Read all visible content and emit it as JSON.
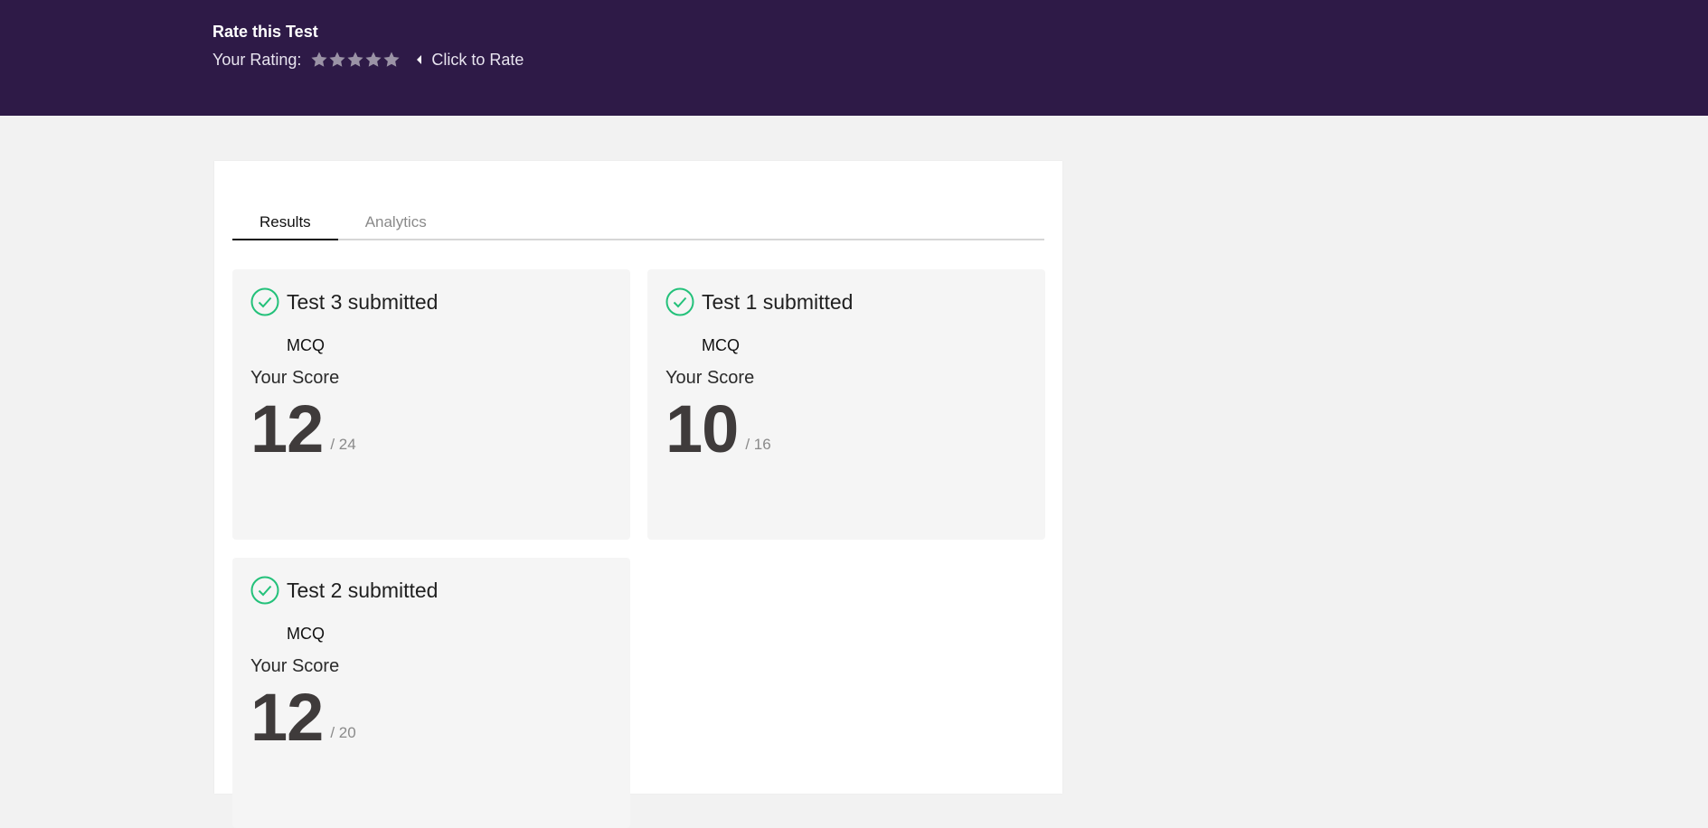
{
  "rating": {
    "title": "Rate this Test",
    "label": "Your Rating:",
    "stars_total": 5,
    "stars_selected": 0,
    "star_color": "#9b93a6",
    "action_label": "Click to Rate"
  },
  "tabs": [
    {
      "label": "Results",
      "active": true
    },
    {
      "label": "Analytics",
      "active": false
    }
  ],
  "results": [
    {
      "title": "Test 3 submitted",
      "type": "MCQ",
      "score_label": "Your Score",
      "score": "12",
      "total": "/ 24"
    },
    {
      "title": "Test 1 submitted",
      "type": "MCQ",
      "score_label": "Your Score",
      "score": "10",
      "total": "/ 16"
    },
    {
      "title": "Test 2 submitted",
      "type": "MCQ",
      "score_label": "Your Score",
      "score": "12",
      "total": "/ 20"
    }
  ],
  "colors": {
    "header_bg": "#2e1a47",
    "check": "#23c17a",
    "score": "#3f3b3b"
  }
}
